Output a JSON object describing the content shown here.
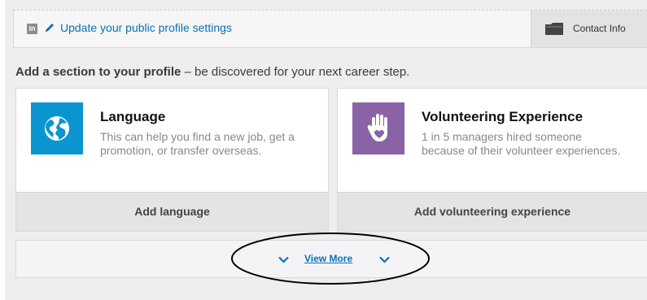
{
  "profile_bar": {
    "linkedin_icon_glyph": "in",
    "update_link": "Update your public profile settings",
    "contact_info": "Contact Info"
  },
  "section_prompt": {
    "bold": "Add a section to your profile",
    "rest": " – be discovered for your next career step."
  },
  "cards": [
    {
      "icon": "globe-icon",
      "icon_color": "#0a95d1",
      "title": "Language",
      "description": "This can help you find a new job, get a promotion, or transfer overseas.",
      "action": "Add language"
    },
    {
      "icon": "raised-hand-heart-icon",
      "icon_color": "#8a62a6",
      "title": "Volunteering Experience",
      "description": "1 in 5 managers hired someone because of their volunteer experiences.",
      "action": "Add volunteering experience"
    }
  ],
  "view_more": {
    "label": "View More"
  },
  "colors": {
    "link": "#0b70b5",
    "page_gray": "#eeeeee",
    "annotation": "#000000"
  }
}
